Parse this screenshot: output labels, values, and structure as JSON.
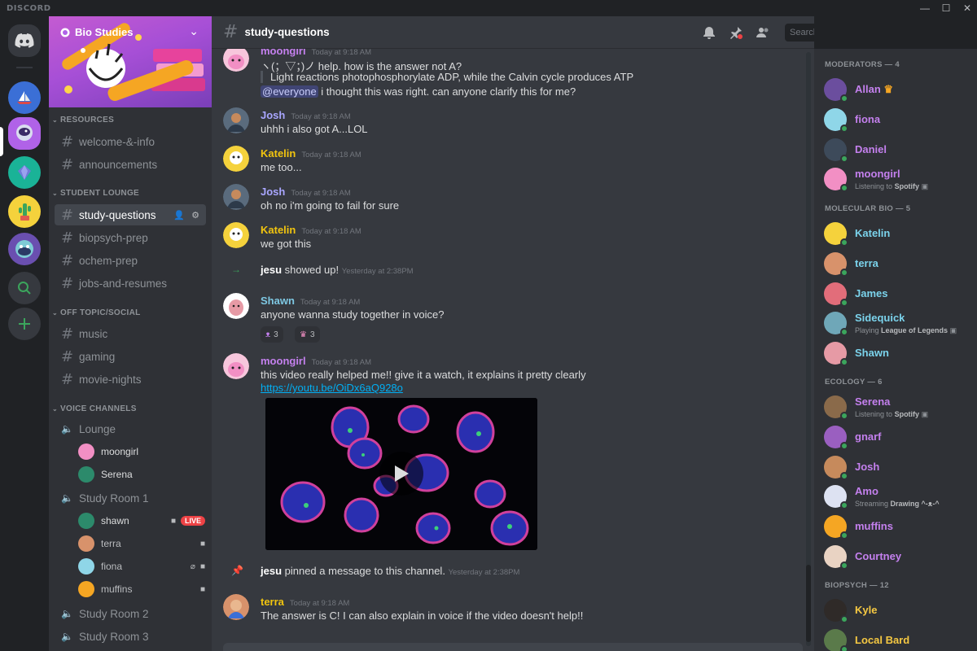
{
  "titlebar": {
    "brand": "DISCORD",
    "minimize": "—",
    "maximize": "☐",
    "close": "✕"
  },
  "server": {
    "name": "Bio Studies"
  },
  "categories": {
    "resources": "RESOURCES",
    "student_lounge": "STUDENT LOUNGE",
    "off_topic": "OFF TOPIC/SOCIAL",
    "voice": "VOICE CHANNELS"
  },
  "channels": {
    "welcome": "welcome-&-info",
    "announcements": "announcements",
    "study_questions": "study-questions",
    "biopsych_prep": "biopsych-prep",
    "ochem_prep": "ochem-prep",
    "jobs": "jobs-and-resumes",
    "music": "music",
    "gaming": "gaming",
    "movie_nights": "movie-nights"
  },
  "voice": {
    "lounge": "Lounge",
    "lounge_users": [
      "moongirl",
      "Serena"
    ],
    "study_room_1": "Study Room 1",
    "room1_users": [
      "shawn",
      "terra",
      "fiona",
      "muffins"
    ],
    "live_badge": "LIVE",
    "study_room_2": "Study Room 2",
    "study_room_3": "Study Room 3"
  },
  "chat": {
    "channel": "study-questions",
    "search_placeholder": "Search",
    "messages": [
      {
        "author": "moongirl",
        "time": "Today at 9:18 AM",
        "line1": "ヽ(；▽；)ノ help. how is the answer not A?",
        "quote": "Light reactions photophosphorylate ADP, while the Calvin cycle produces ATP",
        "mention": "@everyone",
        "line2": " i thought this was right. can anyone clarify this for me?"
      },
      {
        "author": "Josh",
        "time": "Today at 9:18 AM",
        "text": "uhhh i also got A...LOL"
      },
      {
        "author": "Katelin",
        "time": "Today at 9:18 AM",
        "text": "me too..."
      },
      {
        "author": "Josh",
        "time": "Today at 9:18 AM",
        "text": "oh no i'm going to fail for sure"
      },
      {
        "author": "Katelin",
        "time": "Today at 9:18 AM",
        "text": "we got this"
      },
      {
        "author": "Shawn",
        "time": "Today at 9:18 AM",
        "text": "anyone wanna study together in voice?"
      },
      {
        "author": "moongirl",
        "time": "Today at 9:18 AM",
        "text": "this video really helped me!! give it a watch, it explains it pretty clearly",
        "link": "https://youtu.be/OiDx6aQ928o"
      },
      {
        "author": "terra",
        "time": "Today at 9:18 AM",
        "text": "The answer is C! I can also explain in voice if the video doesn't help!!"
      }
    ],
    "system_join": {
      "user": "jesu",
      "text": " showed up!",
      "time": "Yesterday at 2:38PM"
    },
    "system_pin": {
      "user": "jesu",
      "text": " pinned a message to this channel.",
      "time": "Yesterday at 2:38PM"
    },
    "reactions": [
      {
        "count": "3"
      },
      {
        "count": "3"
      }
    ]
  },
  "members": {
    "moderators": "MODERATORS — 4",
    "molecular": "MOLECULAR BIO — 5",
    "ecology": "ECOLOGY — 6",
    "biopsych": "BIOPSYCH — 12",
    "list": {
      "allan": "Allan",
      "fiona": "fiona",
      "daniel": "Daniel",
      "moongirl": "moongirl",
      "moongirl_act": "Listening to",
      "moongirl_act_b": "Spotify",
      "katelin": "Katelin",
      "terra": "terra",
      "james": "James",
      "sidequick": "Sidequick",
      "sidequick_act": "Playing",
      "sidequick_act_b": "League of Legends",
      "shawn": "Shawn",
      "serena": "Serena",
      "serena_act": "Listening to",
      "serena_act_b": "Spotify",
      "gnarf": "gnarf",
      "josh": "Josh",
      "amo": "Amo",
      "amo_act": "Streaming",
      "amo_act_b": "Drawing ^-ᴥ-^",
      "muffins": "muffins",
      "courtney": "Courtney",
      "kyle": "Kyle",
      "localbard": "Local Bard"
    }
  },
  "colors": {
    "moderator": "#c480ee",
    "molecular": "#7bd3ec",
    "ecology": "#c480ee",
    "biopsych": "#f5c842",
    "josh": "#a9a6ff",
    "katelin": "#f1c40f",
    "shawn": "#7ec8e3",
    "moongirl": "#c480ee",
    "terra": "#f1c40f"
  }
}
